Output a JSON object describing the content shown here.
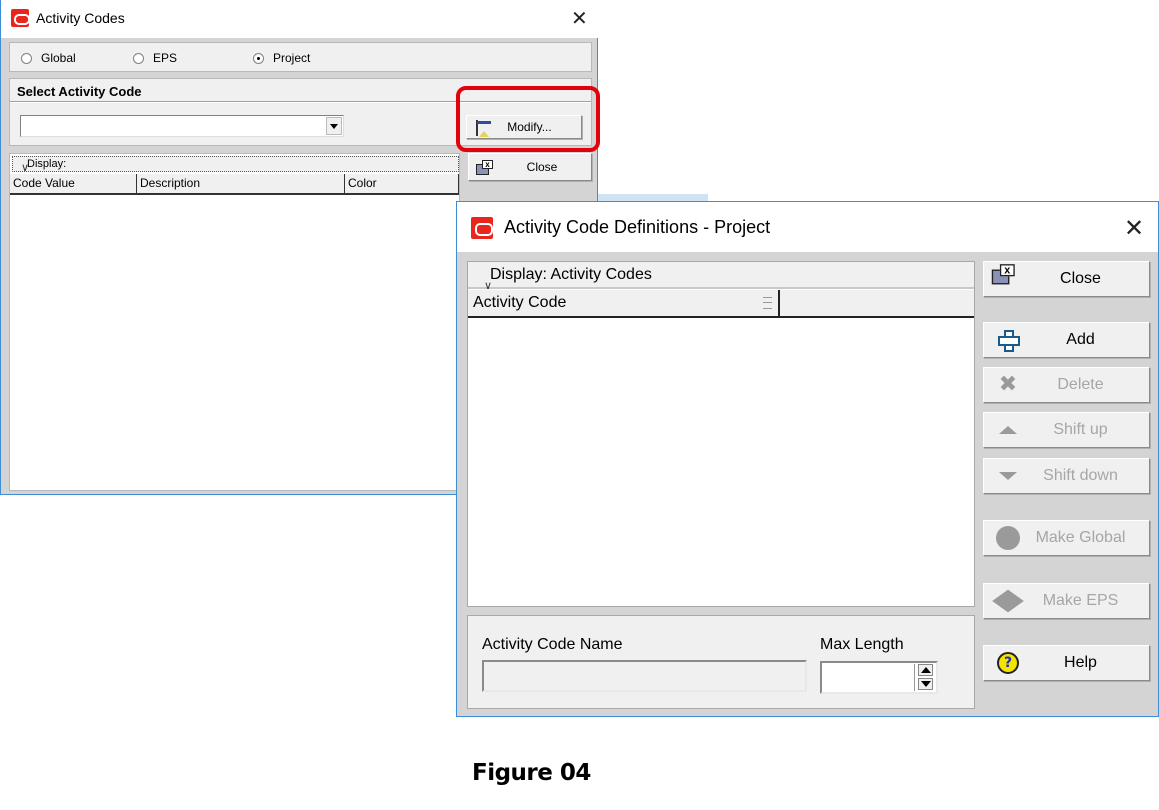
{
  "activity_codes_dialog": {
    "title": "Activity Codes",
    "scope_options": [
      {
        "label": "Global",
        "selected": false
      },
      {
        "label": "EPS",
        "selected": false
      },
      {
        "label": "Project",
        "selected": true
      }
    ],
    "select_section_label": "Select Activity Code",
    "select_value": "",
    "modify_button": "Modify...",
    "close_button": "Close",
    "display_label": "Display:",
    "columns": [
      "Code Value",
      "Description",
      "Color"
    ],
    "rows": []
  },
  "definitions_dialog": {
    "title": "Activity Code Definitions - Project",
    "display_label": "Display: Activity Codes",
    "columns": [
      "Activity Code",
      ""
    ],
    "rows": [],
    "activity_code_name_label": "Activity Code Name",
    "activity_code_name_value": "",
    "max_length_label": "Max Length",
    "max_length_value": "",
    "buttons": {
      "close": {
        "label": "Close",
        "enabled": true
      },
      "add": {
        "label": "Add",
        "enabled": true
      },
      "delete": {
        "label": "Delete",
        "enabled": false
      },
      "shift_up": {
        "label": "Shift up",
        "enabled": false
      },
      "shift_down": {
        "label": "Shift down",
        "enabled": false
      },
      "make_global": {
        "label": "Make Global",
        "enabled": false
      },
      "make_eps": {
        "label": "Make EPS",
        "enabled": false
      },
      "help": {
        "label": "Help",
        "enabled": true
      }
    }
  },
  "caption": "Figure 04",
  "colors": {
    "highlight": "#e3000f",
    "oracle_red": "#e8261e",
    "window_border": "#3c8fd6"
  }
}
